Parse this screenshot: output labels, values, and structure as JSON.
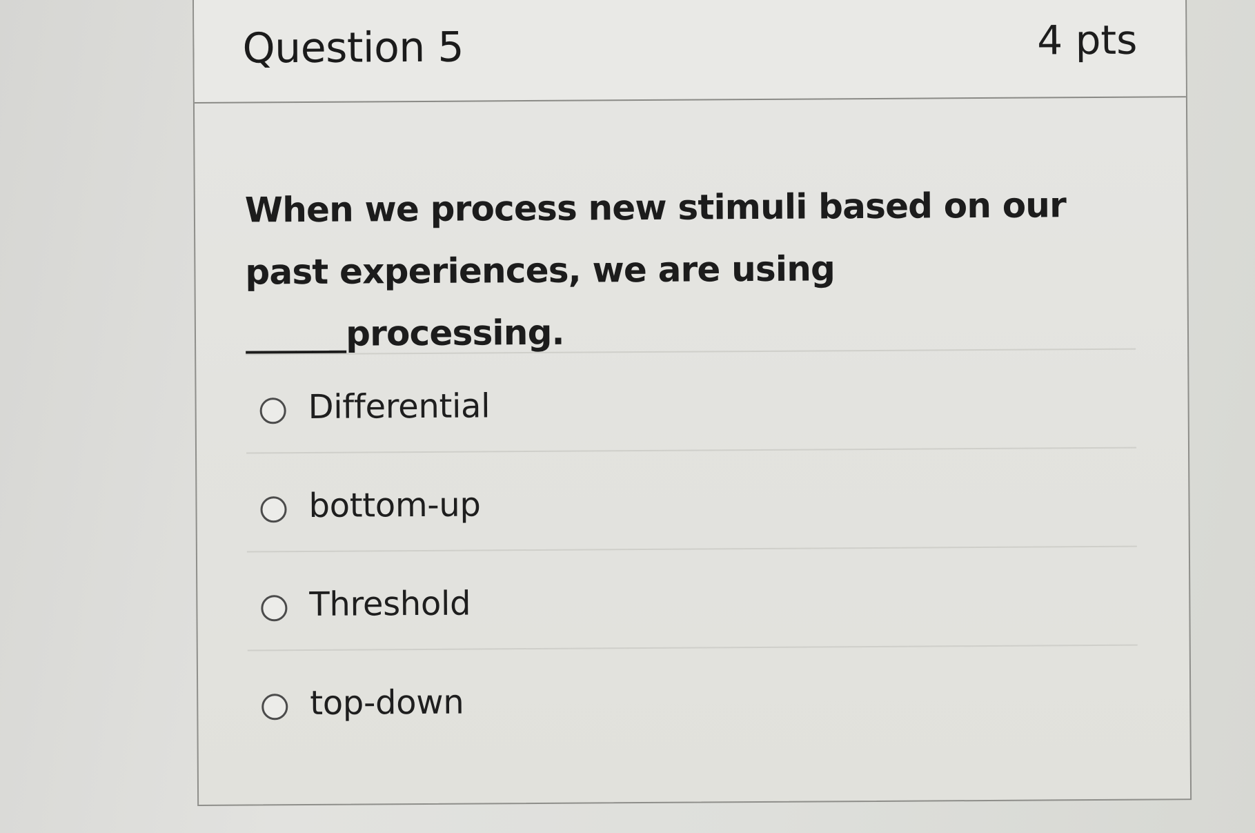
{
  "question": {
    "title": "Question 5",
    "points": "4 pts",
    "text": "When we process new stimuli based on our past experiences, we are using ______processing."
  },
  "answers": [
    {
      "label": "Differential",
      "selected": false
    },
    {
      "label": "bottom-up",
      "selected": false
    },
    {
      "label": "Threshold",
      "selected": false
    },
    {
      "label": "top-down",
      "selected": false
    }
  ]
}
